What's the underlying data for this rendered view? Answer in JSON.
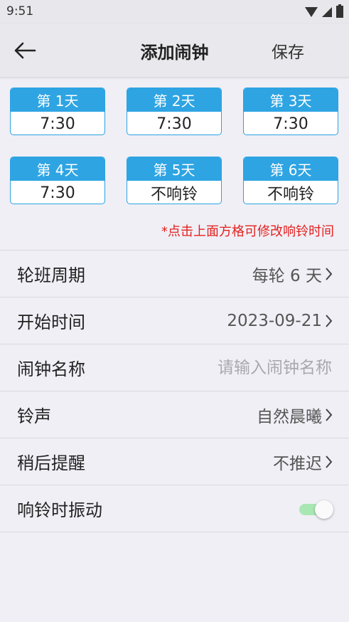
{
  "status": {
    "time": "9:51"
  },
  "header": {
    "title": "添加闹钟",
    "save_label": "保存"
  },
  "days": [
    {
      "label": "第 1天",
      "time": "7:30"
    },
    {
      "label": "第 2天",
      "time": "7:30"
    },
    {
      "label": "第 3天",
      "time": "7:30"
    },
    {
      "label": "第 4天",
      "time": "7:30"
    },
    {
      "label": "第 5天",
      "time": "不响铃"
    },
    {
      "label": "第 6天",
      "time": "不响铃"
    }
  ],
  "hint": "*点击上面方格可修改响铃时间",
  "settings": {
    "cycle": {
      "label": "轮班周期",
      "value": "每轮 6 天"
    },
    "start": {
      "label": "开始时间",
      "value": "2023-09-21"
    },
    "name": {
      "label": "闹钟名称",
      "placeholder": "请输入闹钟名称"
    },
    "ringtone": {
      "label": "铃声",
      "value": "自然晨曦"
    },
    "snooze": {
      "label": "稍后提醒",
      "value": "不推迟"
    },
    "vibrate": {
      "label": "响铃时振动",
      "enabled": true
    }
  },
  "colors": {
    "accent": "#2ea4e3",
    "hint": "#e4211f",
    "toggle_on": "#a8e6b4"
  }
}
